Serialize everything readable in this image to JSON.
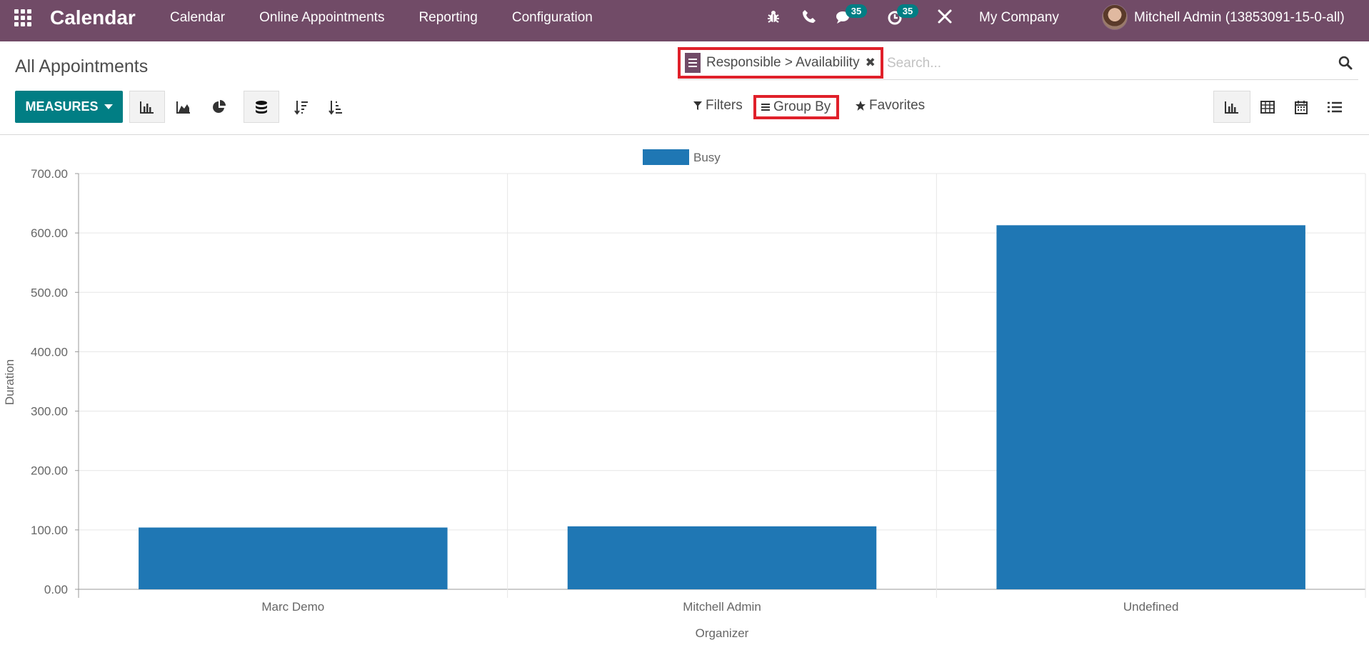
{
  "navbar": {
    "app_name": "Calendar",
    "menu": [
      "Calendar",
      "Online Appointments",
      "Reporting",
      "Configuration"
    ],
    "messages_count": "35",
    "activities_count": "35",
    "company": "My Company",
    "user": "Mitchell Admin (13853091-15-0-all)",
    "background_color": "#714b67"
  },
  "control_panel": {
    "title": "All Appointments",
    "measures_label": "MEASURES",
    "search": {
      "facet_label": "Responsible > Availability",
      "placeholder": "Search..."
    },
    "filters_label": "Filters",
    "group_by_label": "Group By",
    "favorites_label": "Favorites",
    "chart_tools": [
      "bar-chart-icon",
      "line-chart-icon",
      "pie-chart-icon",
      "stacked-icon",
      "sort-descending-icon",
      "sort-ascending-icon"
    ],
    "views": [
      "graph-view-icon",
      "pivot-view-icon",
      "calendar-view-icon",
      "list-view-icon"
    ],
    "accent_color": "#017e84",
    "highlight_color": "#e0202a"
  },
  "chart_data": {
    "type": "bar",
    "categories": [
      "Marc Demo",
      "Mitchell Admin",
      "Undefined"
    ],
    "series": [
      {
        "name": "Busy",
        "values": [
          104,
          106,
          613
        ],
        "color": "#1f77b4"
      }
    ],
    "xlabel": "Organizer",
    "ylabel": "Duration",
    "ylim": [
      0,
      700
    ],
    "yticks": [
      "0.00",
      "100.00",
      "200.00",
      "300.00",
      "400.00",
      "500.00",
      "600.00",
      "700.00"
    ],
    "legend_position": "top-center",
    "grid": true
  }
}
